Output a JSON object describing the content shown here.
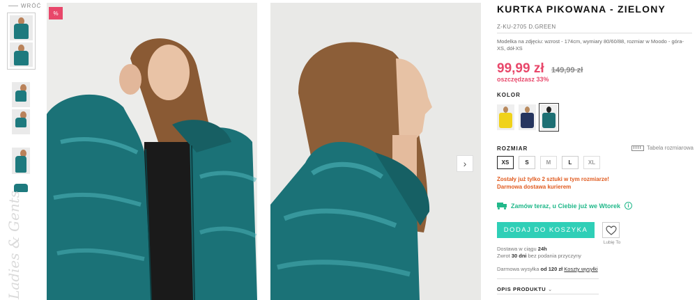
{
  "nav": {
    "back_label": "WRÓĆ"
  },
  "thumbnails": [
    {
      "name": "thumb-front"
    },
    {
      "name": "thumb-side"
    },
    {
      "name": "thumb-full"
    },
    {
      "name": "thumb-full-2"
    },
    {
      "name": "thumb-close"
    },
    {
      "name": "thumb-product"
    }
  ],
  "gallery": {
    "sale_badge": "%",
    "next_label": "›",
    "watermark": "Ladies & Gents"
  },
  "product": {
    "title": "KURTKA PIKOWANA  - ZIELONY",
    "sku": "Z-KU-2705 D.GREEN",
    "model_info": "Modelka na zdjęciu: wzrost - 174cm, wymiary 80/60/88, rozmiar w Moodo - góra-XS, dół-XS",
    "price": "99,99 zł",
    "old_price": "149,99 zł",
    "savings": "oszczędzasz 33%",
    "color_label": "KOLOR",
    "colors": [
      {
        "name": "yellow",
        "hex": "#f0d21a"
      },
      {
        "name": "navy",
        "hex": "#26355e"
      },
      {
        "name": "green",
        "hex": "#1d6f73"
      }
    ],
    "size_label": "ROZMIAR",
    "size_guide": "Tabela rozmiarowa",
    "sizes": [
      "XS",
      "S",
      "M",
      "L",
      "XL"
    ],
    "stock_warning": "Zostały już tylko 2 sztuki w tym rozmiarze!",
    "shipping_note": "Darmowa dostawa kurierem",
    "order_today": "Zamów teraz, u Ciebie już we Wtorek",
    "add_to_cart": "DODAJ DO KOSZYKA",
    "wishlist_label": "Lubię To",
    "delivery_time_prefix": "Dostawa w ciągu ",
    "delivery_time": "24h",
    "return_prefix": "Zwrot ",
    "return_days": "30 dni",
    "return_suffix": " bez podania przyczyny",
    "free_shipping_prefix": "Darmowa wysyłka ",
    "free_shipping_value": "od 120 zł",
    "shipping_costs_link": "Koszty wysyłki",
    "description_label": "OPIS PRODUKTU"
  },
  "colors": {
    "accent": "#e8476a",
    "cta": "#2fcfb7",
    "success": "#21b88a",
    "warning": "#e05a1e"
  }
}
